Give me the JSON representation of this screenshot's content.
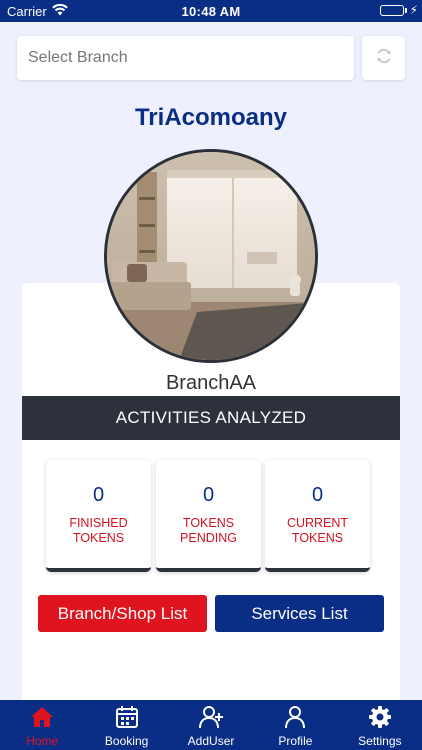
{
  "status_bar": {
    "carrier": "Carrier",
    "time": "10:48 AM"
  },
  "branch_select": {
    "placeholder": "Select Branch"
  },
  "company_name": "TriAcomoany",
  "branch_name": "BranchAA",
  "activities_title": "ACTIVITIES ANALYZED",
  "stats": [
    {
      "value": "0",
      "label_line1": "FINISHED",
      "label_line2": "TOKENS"
    },
    {
      "value": "0",
      "label_line1": "TOKENS",
      "label_line2": "PENDING"
    },
    {
      "value": "0",
      "label_line1": "CURRENT",
      "label_line2": "TOKENS"
    }
  ],
  "buttons": {
    "branch_shop_list": "Branch/Shop List",
    "services_list": "Services List"
  },
  "tabbar": [
    {
      "label": "Home",
      "icon": "home-icon",
      "active": true
    },
    {
      "label": "Booking",
      "icon": "calendar-icon",
      "active": false
    },
    {
      "label": "AddUser",
      "icon": "add-user-icon",
      "active": false
    },
    {
      "label": "Profile",
      "icon": "user-icon",
      "active": false
    },
    {
      "label": "Settings",
      "icon": "gear-icon",
      "active": false
    }
  ],
  "colors": {
    "primary": "#0a2e86",
    "accent": "#e0141f",
    "background": "#eef1fd",
    "dark_bar": "#2c313b"
  }
}
